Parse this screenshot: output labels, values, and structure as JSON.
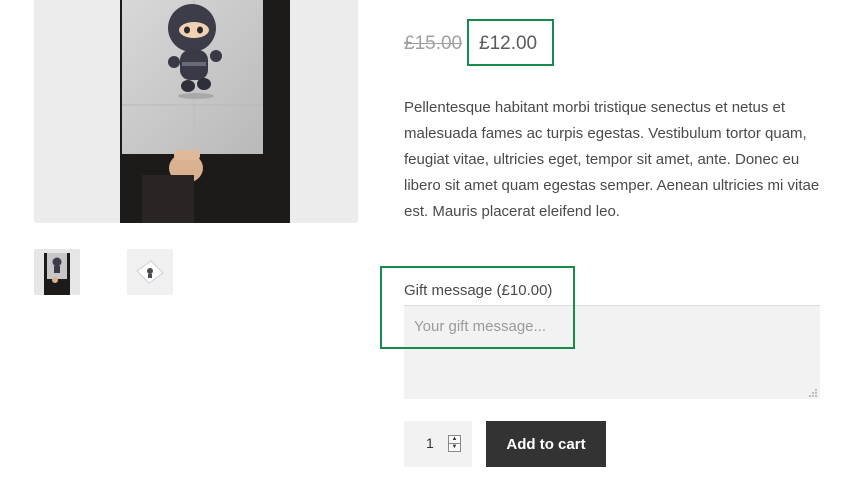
{
  "product_gallery": {
    "main_image_icon": "ninja-poster-image",
    "thumbnails": [
      {
        "icon": "ninja-poster-held-thumbnail"
      },
      {
        "icon": "ninja-poster-flat-thumbnail"
      }
    ]
  },
  "price": {
    "regular": "£15.00",
    "sale": "£12.00"
  },
  "description": "Pellentesque habitant morbi tristique senectus et netus et malesuada fames ac turpis egestas. Vestibulum tortor quam, feugiat vitae, ultricies eget, tempor sit amet, ante. Donec eu libero sit amet quam egestas semper. Aenean ultricies mi vitae est. Mauris placerat eleifend leo.",
  "gift_message": {
    "label": "Gift message (£10.00)",
    "placeholder": "Your gift message...",
    "value": ""
  },
  "cart": {
    "quantity": "1",
    "add_to_cart_label": "Add to cart"
  },
  "colors": {
    "highlight_border": "#178c4a",
    "button_bg": "#333333",
    "field_bg": "#f2f2f2"
  }
}
